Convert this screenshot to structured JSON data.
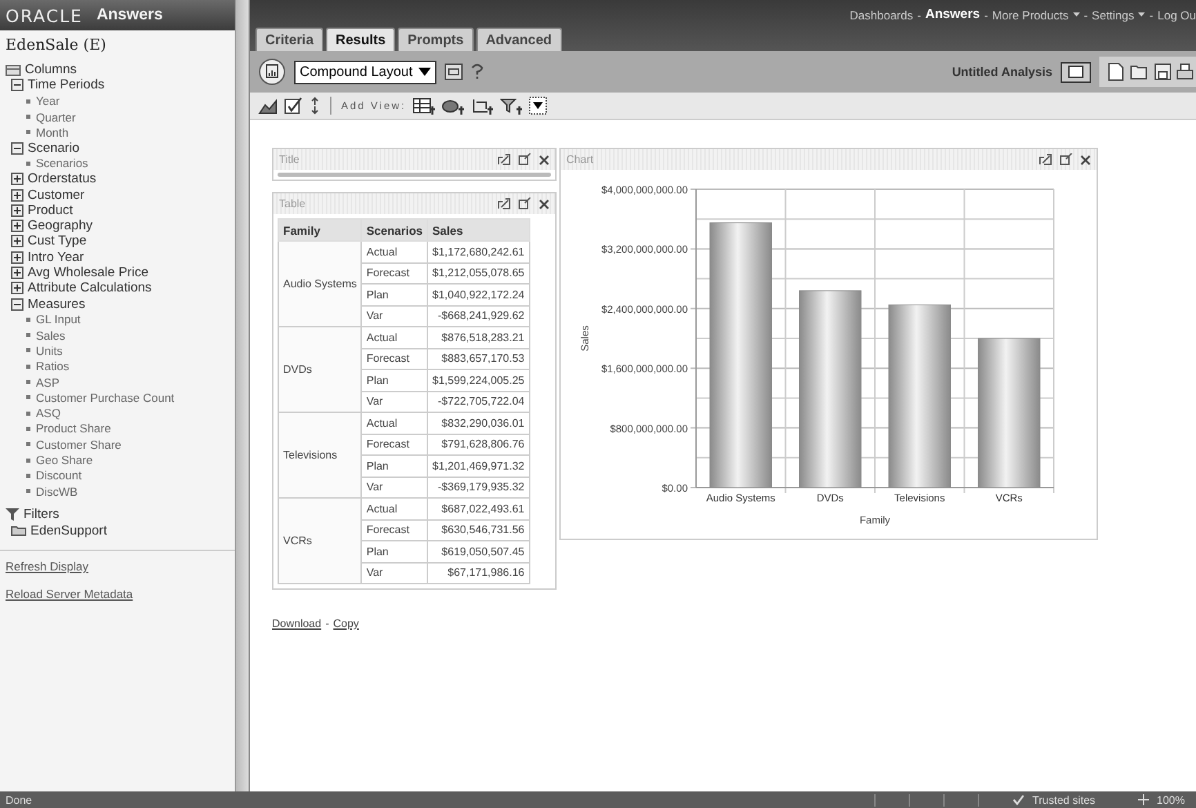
{
  "sidebar": {
    "logo": "ORACLE",
    "product": "Answers",
    "subject_area": "EdenSale (E)",
    "columns_label": "Columns",
    "tree": [
      {
        "label": "Time Periods",
        "expanded": true,
        "children": [
          {
            "label": "Year"
          },
          {
            "label": "Quarter"
          },
          {
            "label": "Month"
          }
        ]
      },
      {
        "label": "Scenario",
        "expanded": true,
        "children": [
          {
            "label": "Scenarios"
          }
        ]
      },
      {
        "label": "Orderstatus",
        "expanded": false
      },
      {
        "label": "Customer",
        "expanded": false
      },
      {
        "label": "Product",
        "expanded": false
      },
      {
        "label": "Geography",
        "expanded": false
      },
      {
        "label": "Cust Type",
        "expanded": false
      },
      {
        "label": "Intro Year",
        "expanded": false
      },
      {
        "label": "Avg Wholesale Price",
        "expanded": false
      },
      {
        "label": "Attribute Calculations",
        "expanded": false
      },
      {
        "label": "Measures",
        "expanded": true,
        "children": [
          {
            "label": "GL Input"
          },
          {
            "label": "Sales"
          },
          {
            "label": "Units"
          },
          {
            "label": "Ratios"
          },
          {
            "label": "ASP"
          },
          {
            "label": "Customer Purchase Count"
          },
          {
            "label": "ASQ"
          },
          {
            "label": "Product Share"
          },
          {
            "label": "Customer Share"
          },
          {
            "label": "Geo Share"
          },
          {
            "label": "Discount"
          },
          {
            "label": "DiscWB"
          }
        ]
      }
    ],
    "filters_label": "Filters",
    "filters": [
      {
        "label": "EdenSupport"
      }
    ],
    "links": [
      "Refresh Display",
      "Reload Server Metadata"
    ]
  },
  "tabs": [
    {
      "label": "Criteria",
      "selected": false
    },
    {
      "label": "Results",
      "selected": true
    },
    {
      "label": "Prompts",
      "selected": false
    },
    {
      "label": "Advanced",
      "selected": false
    }
  ],
  "separator": "-",
  "global_links": [
    {
      "label": "Dashboards",
      "selected": false,
      "menu": false
    },
    {
      "label": "Answers",
      "selected": true,
      "menu": false
    },
    {
      "label": "More Products",
      "selected": false,
      "menu": true
    },
    {
      "label": "Settings",
      "selected": false,
      "menu": true
    },
    {
      "label": "Log Ou",
      "selected": false,
      "menu": false
    }
  ],
  "toolbar": {
    "layout": "Compound Layout",
    "analysis_name": "Untitled Analysis",
    "add_view_label": "Add View:"
  },
  "title_view": {
    "label": "Title"
  },
  "table_view": {
    "label": "Table",
    "columns": [
      "Family",
      "Scenarios",
      "Sales"
    ],
    "groups": [
      {
        "family": "Audio Systems",
        "rows": [
          {
            "scenario": "Actual",
            "sales": "$1,172,680,242.61"
          },
          {
            "scenario": "Forecast",
            "sales": "$1,212,055,078.65"
          },
          {
            "scenario": "Plan",
            "sales": "$1,040,922,172.24"
          },
          {
            "scenario": "Var",
            "sales": "-$668,241,929.62"
          }
        ]
      },
      {
        "family": "DVDs",
        "rows": [
          {
            "scenario": "Actual",
            "sales": "$876,518,283.21"
          },
          {
            "scenario": "Forecast",
            "sales": "$883,657,170.53"
          },
          {
            "scenario": "Plan",
            "sales": "$1,599,224,005.25"
          },
          {
            "scenario": "Var",
            "sales": "-$722,705,722.04"
          }
        ]
      },
      {
        "family": "Televisions",
        "rows": [
          {
            "scenario": "Actual",
            "sales": "$832,290,036.01"
          },
          {
            "scenario": "Forecast",
            "sales": "$791,628,806.76"
          },
          {
            "scenario": "Plan",
            "sales": "$1,201,469,971.32"
          },
          {
            "scenario": "Var",
            "sales": "-$369,179,935.32"
          }
        ]
      },
      {
        "family": "VCRs",
        "rows": [
          {
            "scenario": "Actual",
            "sales": "$687,022,493.61"
          },
          {
            "scenario": "Forecast",
            "sales": "$630,546,731.56"
          },
          {
            "scenario": "Plan",
            "sales": "$619,050,507.45"
          },
          {
            "scenario": "Var",
            "sales": "$67,171,986.16"
          }
        ]
      }
    ]
  },
  "chart_view": {
    "label": "Chart",
    "chart_data": {
      "type": "bar",
      "xlabel": "Family",
      "ylabel": "Sales",
      "categories": [
        "Audio Systems",
        "DVDs",
        "Televisions",
        "VCRs"
      ],
      "grid": true,
      "series": [
        {
          "color": "#8a8a8a",
          "values": [
            3550000000,
            2640000000,
            2450000000,
            2000000000
          ]
        }
      ],
      "ylim": [
        0,
        4000000000
      ],
      "yticks": [
        {
          "value": 0,
          "label": "$0.00"
        },
        {
          "value": 800000000,
          "label": "$800,000,000.00"
        },
        {
          "value": 1600000000,
          "label": "$1,600,000,000.00"
        },
        {
          "value": 2400000000,
          "label": "$2,400,000,000.00"
        },
        {
          "value": 3200000000,
          "label": "$3,200,000,000.00"
        },
        {
          "value": 4000000000,
          "label": "$4,000,000,000.00"
        }
      ]
    }
  },
  "result_links": [
    "Download",
    "Copy"
  ],
  "status_bar": {
    "status": "Done",
    "zone": "Trusted sites",
    "zoom": "100%"
  }
}
